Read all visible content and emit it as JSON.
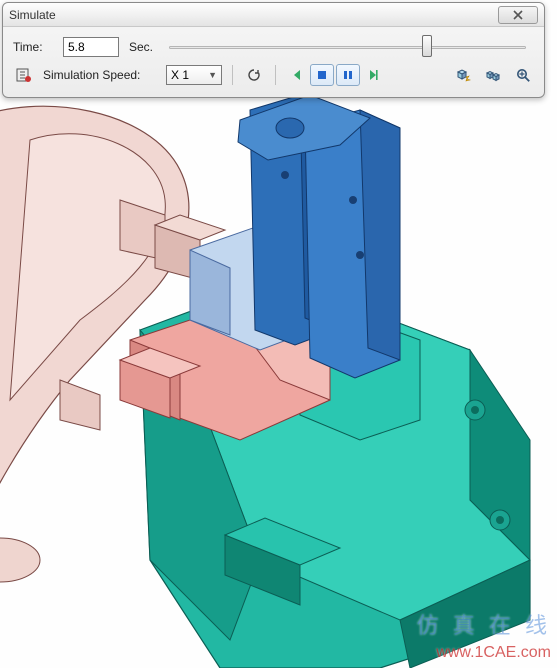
{
  "dialog": {
    "title": "Simulate",
    "time_label": "Time:",
    "time_value": "5.8",
    "time_unit": "Sec.",
    "slider_pos_pct": 71,
    "speed_label": "Simulation Speed:",
    "speed_value": "X 1"
  },
  "watermark": {
    "line1": "仿 真 在 线",
    "line2": "www.1CAE.com"
  }
}
